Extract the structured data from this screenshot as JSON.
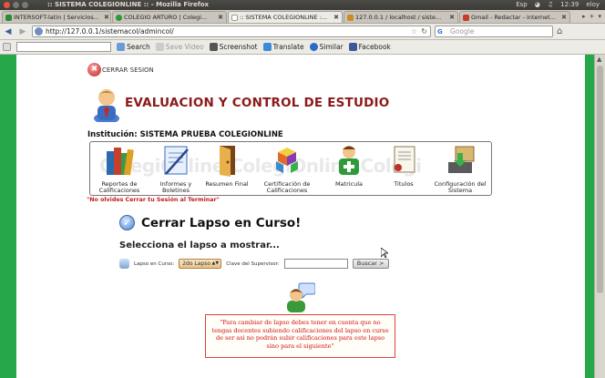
{
  "os": {
    "window_title": ":: SISTEMA COLEGIONLINE :: - Mozilla Firefox",
    "tray": [
      "Esp",
      "12:39",
      "eloy"
    ]
  },
  "tabs": [
    {
      "label": "INTERSOFT-latin | Servicios...",
      "color": "#2c8a3a",
      "active": false
    },
    {
      "label": "COLEGIO ARTURO | Colegi...",
      "color": "#2a9a3a",
      "active": false
    },
    {
      "label": ":: SISTEMA COLEGIONLINE :...",
      "color": "#9a9a9a",
      "active": true
    },
    {
      "label": "127.0.0.1 / localhost / siste...",
      "color": "#d08a20",
      "active": false
    },
    {
      "label": "Gmail - Redactar - internet...",
      "color": "#c83a2a",
      "active": false
    }
  ],
  "nav": {
    "url": "http://127.0.0.1/sistemacol/admincol/",
    "search_placeholder": "Google",
    "search_logo": "G"
  },
  "toolbar": {
    "search_label": "Search",
    "save_video_label": "Save Video",
    "screenshot_label": "Screenshot",
    "translate_label": "Translate",
    "similar_label": "Similar",
    "facebook_label": "Facebook"
  },
  "page": {
    "logout_label": "CERRAR SESION",
    "app_title": "EVALUACION Y CONTROL DE ESTUDIO",
    "institution_label": "Institución: SISTEMA PRUEBA COLEGIONLINE",
    "watermark": "ColegiOnline  ColegiOnline  Colegi",
    "menu": [
      {
        "label": "Reportes de Calificaciones",
        "icon": "books-icon"
      },
      {
        "label": "Informes y Boletines",
        "icon": "notebook-icon"
      },
      {
        "label": "Resumen Final",
        "icon": "door-icon"
      },
      {
        "label": "Certificación de Calificaciones",
        "icon": "blocks-icon"
      },
      {
        "label": "Matricula",
        "icon": "add-user-icon"
      },
      {
        "label": "Titulos",
        "icon": "diploma-icon"
      },
      {
        "label": "Configuración del Sistema",
        "icon": "settings-icon"
      }
    ],
    "warning": "\"No olvides Cerrar tu Sesión al Terminar\"",
    "close_title": "Cerrar Lapso en Curso!",
    "select_title": "Selecciona el lapso a mostrar...",
    "lapso_label": "Lapso en Curso:",
    "lapso_value": "2do Lapso",
    "supervisor_label": "Clave del Supervisor:",
    "search_button": "Buscar >",
    "note": "\"Para cambiar de lapso debes tener en cuenta que no tengas docentes subiendo calificaciones del lapso en curso de ser asi no podrán subir calificaciones para este lapso sino para el siguiente\""
  }
}
